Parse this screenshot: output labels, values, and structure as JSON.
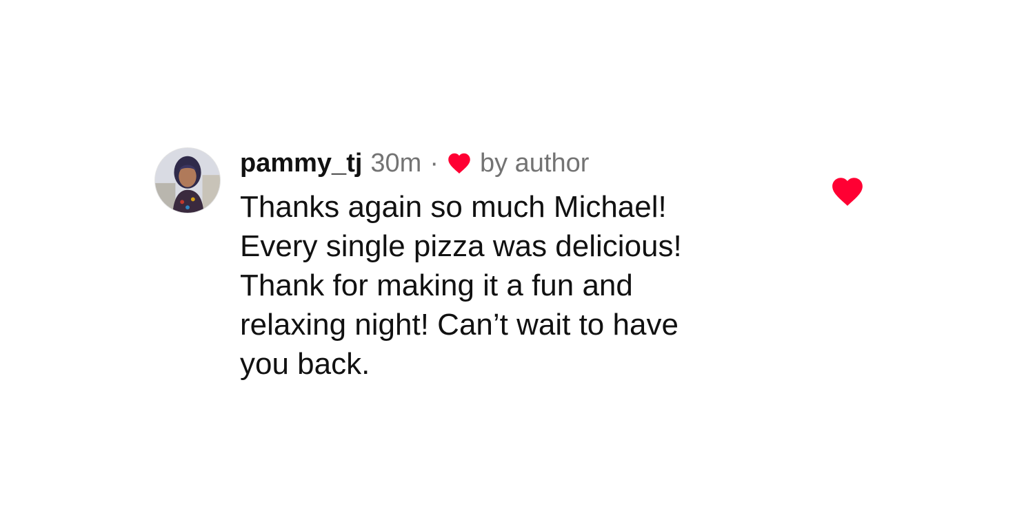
{
  "comment": {
    "username": "pammy_tj",
    "time": "30m",
    "separator": "·",
    "liked_by_author_label": "by author",
    "text": "Thanks again so much Michael!\nEvery single pizza was delicious!\nThank for making it a fun and\nrelaxing night! Can’t wait to have\nyou back.",
    "liked": true
  },
  "icons": {
    "author_like": "heart-icon",
    "like_button": "heart-icon"
  },
  "colors": {
    "heart": "#ff0033",
    "secondary_text": "#737373",
    "primary_text": "#111111"
  }
}
